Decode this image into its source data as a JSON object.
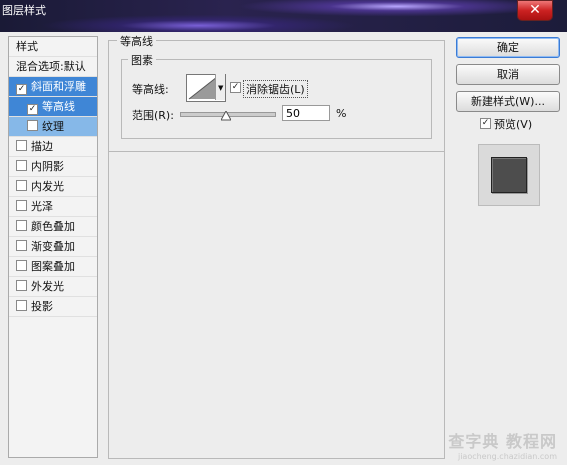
{
  "window": {
    "title": "图层样式",
    "close_glyph": "✕"
  },
  "styles_list": {
    "header": "样式",
    "blend_options": "混合选项:默认",
    "items": [
      {
        "label": "斜面和浮雕",
        "checked": true
      },
      {
        "label": "等高线",
        "checked": true
      },
      {
        "label": "纹理",
        "checked": false
      },
      {
        "label": "描边",
        "checked": false
      },
      {
        "label": "内阴影",
        "checked": false
      },
      {
        "label": "内发光",
        "checked": false
      },
      {
        "label": "光泽",
        "checked": false
      },
      {
        "label": "颜色叠加",
        "checked": false
      },
      {
        "label": "渐变叠加",
        "checked": false
      },
      {
        "label": "图案叠加",
        "checked": false
      },
      {
        "label": "外发光",
        "checked": false
      },
      {
        "label": "投影",
        "checked": false
      }
    ]
  },
  "contour_panel": {
    "title": "等高线",
    "group": "图素",
    "contour_label": "等高线:",
    "antialias_label": "消除锯齿(L)",
    "antialias_checked": true,
    "range_label": "范围(R):",
    "range_value": "50",
    "range_unit": "%",
    "range_fraction": 0.5
  },
  "buttons": {
    "ok": "确定",
    "cancel": "取消",
    "new_style": "新建样式(W)...",
    "preview_label": "预览(V)",
    "preview_checked": true
  },
  "colors": {
    "selected_row": "#3f86d6",
    "selected_subrow": "#86b8e8",
    "preview_swatch": "#4d4d4d"
  },
  "watermark": {
    "line1": "查字典 教程网",
    "line2": "jiaocheng.chazidian.com"
  }
}
